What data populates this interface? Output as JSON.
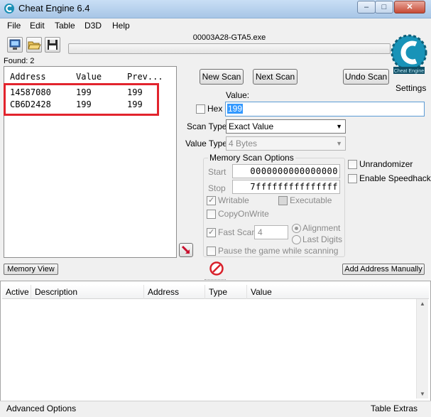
{
  "window": {
    "title": "Cheat Engine 6.4",
    "minimize": "–",
    "maximize": "□",
    "close": "✕"
  },
  "menu": [
    "File",
    "Edit",
    "Table",
    "D3D",
    "Help"
  ],
  "process_name": "00003A28-GTA5.exe",
  "found_label": "Found: 2",
  "results": {
    "columns": [
      "Address",
      "Value",
      "Prev..."
    ],
    "rows": [
      {
        "address": "14587080",
        "value": "199",
        "previous": "199"
      },
      {
        "address": "CB6D2428",
        "value": "199",
        "previous": "199"
      }
    ]
  },
  "buttons": {
    "new_scan": "New Scan",
    "next_scan": "Next Scan",
    "undo_scan": "Undo Scan",
    "settings": "Settings",
    "memory_view": "Memory View",
    "add_address": "Add Address Manually"
  },
  "scan": {
    "value_label": "Value:",
    "hex_label": "Hex",
    "value": "199",
    "scan_type_label": "Scan Type",
    "scan_type": "Exact Value",
    "value_type_label": "Value Type",
    "value_type": "4 Bytes"
  },
  "memory_options": {
    "title": "Memory Scan Options",
    "start_label": "Start",
    "start": "0000000000000000",
    "stop_label": "Stop",
    "stop": "7fffffffffffffff",
    "writable": "Writable",
    "executable": "Executable",
    "copy_on_write": "CopyOnWrite",
    "fast_scan": "Fast Scan",
    "fast_scan_value": "4",
    "alignment": "Alignment",
    "last_digits": "Last Digits",
    "pause": "Pause the game while scanning"
  },
  "extras": {
    "unrandomizer": "Unrandomizer",
    "speedhack": "Enable Speedhack"
  },
  "logo_text": "Cheat Engine",
  "address_table": {
    "columns": [
      "Active",
      "Description",
      "Address",
      "Type",
      "Value"
    ]
  },
  "status": {
    "left": "Advanced Options",
    "right": "Table Extras"
  }
}
